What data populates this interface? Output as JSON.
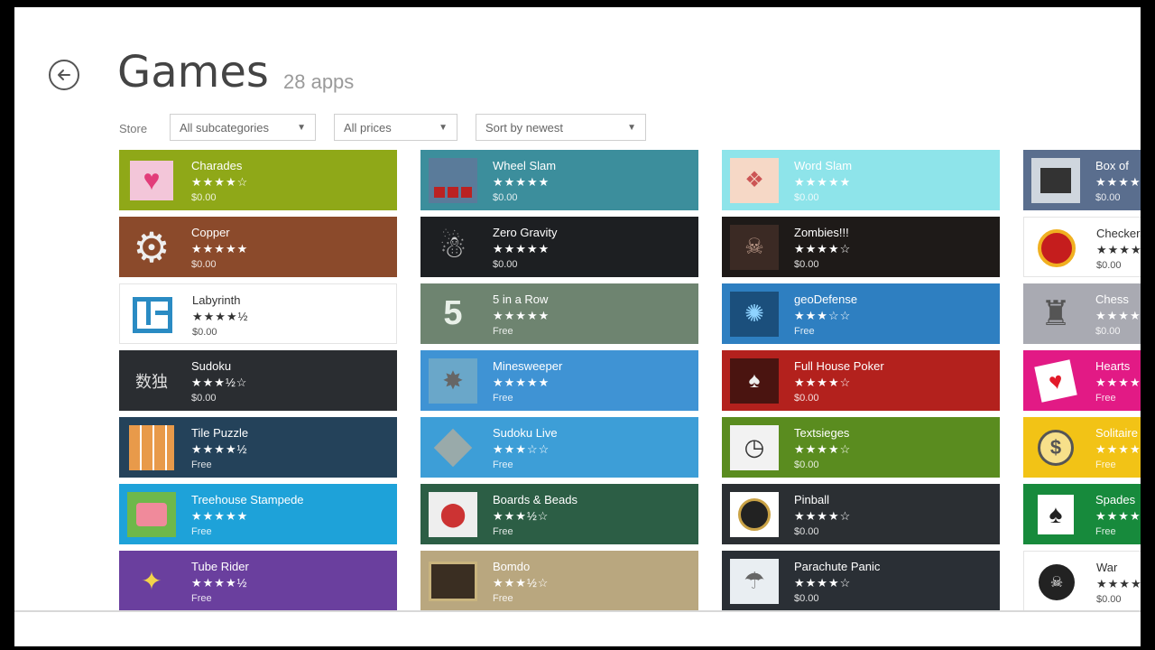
{
  "header": {
    "title": "Games",
    "count": "28 apps"
  },
  "filters": {
    "label": "Store",
    "subcategory": "All subcategories",
    "prices": "All prices",
    "sort": "Sort by newest"
  },
  "apps": [
    {
      "name": "Charades",
      "stars": "★★★★☆",
      "price": "$0.00",
      "bg": "#8fa818",
      "icon": "heart-icon"
    },
    {
      "name": "Copper",
      "stars": "★★★★★",
      "price": "$0.00",
      "bg": "#8b4a2b",
      "icon": "gear-icon"
    },
    {
      "name": "Labyrinth",
      "stars": "★★★★½",
      "price": "$0.00",
      "bg": "#ffffff",
      "icon": "maze-icon"
    },
    {
      "name": "Sudoku",
      "stars": "★★★½☆",
      "price": "$0.00",
      "bg": "#2a2d31",
      "icon": "sudoku-grid-icon"
    },
    {
      "name": "Tile Puzzle",
      "stars": "★★★★½",
      "price": "Free",
      "bg": "#24425a",
      "icon": "tile-puzzle-icon"
    },
    {
      "name": "Treehouse Stampede",
      "stars": "★★★★★",
      "price": "Free",
      "bg": "#1ea2d9",
      "icon": "treehouse-icon"
    },
    {
      "name": "Tube Rider",
      "stars": "★★★★½",
      "price": "Free",
      "bg": "#6a3f9e",
      "icon": "tube-rider-icon"
    },
    {
      "name": "Wheel Slam",
      "stars": "★★★★★",
      "price": "$0.00",
      "bg": "#3c8e9c",
      "icon": "dice-icon"
    },
    {
      "name": "Zero Gravity",
      "stars": "★★★★★",
      "price": "$0.00",
      "bg": "#1d1f22",
      "icon": "astronaut-icon"
    },
    {
      "name": "5 in a Row",
      "stars": "★★★★★",
      "price": "Free",
      "bg": "#6e8470",
      "icon": "five-icon"
    },
    {
      "name": "Minesweeper",
      "stars": "★★★★★",
      "price": "Free",
      "bg": "#3f93d4",
      "icon": "mine-icon"
    },
    {
      "name": "Sudoku Live",
      "stars": "★★★☆☆",
      "price": "Free",
      "bg": "#3d9ed7",
      "icon": "diamond-board-icon"
    },
    {
      "name": "Boards & Beads",
      "stars": "★★★½☆",
      "price": "Free",
      "bg": "#2c5e45",
      "icon": "boards-icon"
    },
    {
      "name": "Bomdo",
      "stars": "★★★½☆",
      "price": "Free",
      "bg": "#b9a77f",
      "icon": "bomdo-icon"
    },
    {
      "name": "Word Slam",
      "stars": "★★★★★",
      "price": "$0.00",
      "bg": "#8ee4ea",
      "icon": "cards-icon"
    },
    {
      "name": "Zombies!!!",
      "stars": "★★★★☆",
      "price": "$0.00",
      "bg": "#1e1a18",
      "icon": "zombie-icon"
    },
    {
      "name": "geoDefense",
      "stars": "★★★☆☆",
      "price": "Free",
      "bg": "#2e7fc1",
      "icon": "geodefense-icon"
    },
    {
      "name": "Full House Poker",
      "stars": "★★★★☆",
      "price": "$0.00",
      "bg": "#b3211d",
      "icon": "poker-icon"
    },
    {
      "name": "Textsieges",
      "stars": "★★★★☆",
      "price": "$0.00",
      "bg": "#5a8c1f",
      "icon": "clock-icon"
    },
    {
      "name": "Pinball",
      "stars": "★★★★☆",
      "price": "$0.00",
      "bg": "#2b2f33",
      "icon": "pinball-icon"
    },
    {
      "name": "Parachute Panic",
      "stars": "★★★★☆",
      "price": "$0.00",
      "bg": "#2a2f35",
      "icon": "parachute-icon"
    },
    {
      "name": "Box of",
      "stars": "★★★★★",
      "price": "$0.00",
      "bg": "#5a6e8e",
      "icon": "photo-icon"
    },
    {
      "name": "Checkers",
      "stars": "★★★★★",
      "price": "$0.00",
      "bg": "#ffffff",
      "icon": "checkers-icon"
    },
    {
      "name": "Chess",
      "stars": "★★★★★",
      "price": "$0.00",
      "bg": "#a9aab2",
      "icon": "chess-icon"
    },
    {
      "name": "Hearts",
      "stars": "★★★★★",
      "price": "Free",
      "bg": "#e21a85",
      "icon": "hearts-card-icon"
    },
    {
      "name": "Solitaire",
      "stars": "★★★★★",
      "price": "Free",
      "bg": "#f2c316",
      "icon": "dollar-icon"
    },
    {
      "name": "Spades",
      "stars": "★★★★★",
      "price": "Free",
      "bg": "#178a3c",
      "icon": "spades-icon"
    },
    {
      "name": "War",
      "stars": "★★★★★",
      "price": "$0.00",
      "bg": "#ffffff",
      "icon": "bomb-icon"
    }
  ]
}
